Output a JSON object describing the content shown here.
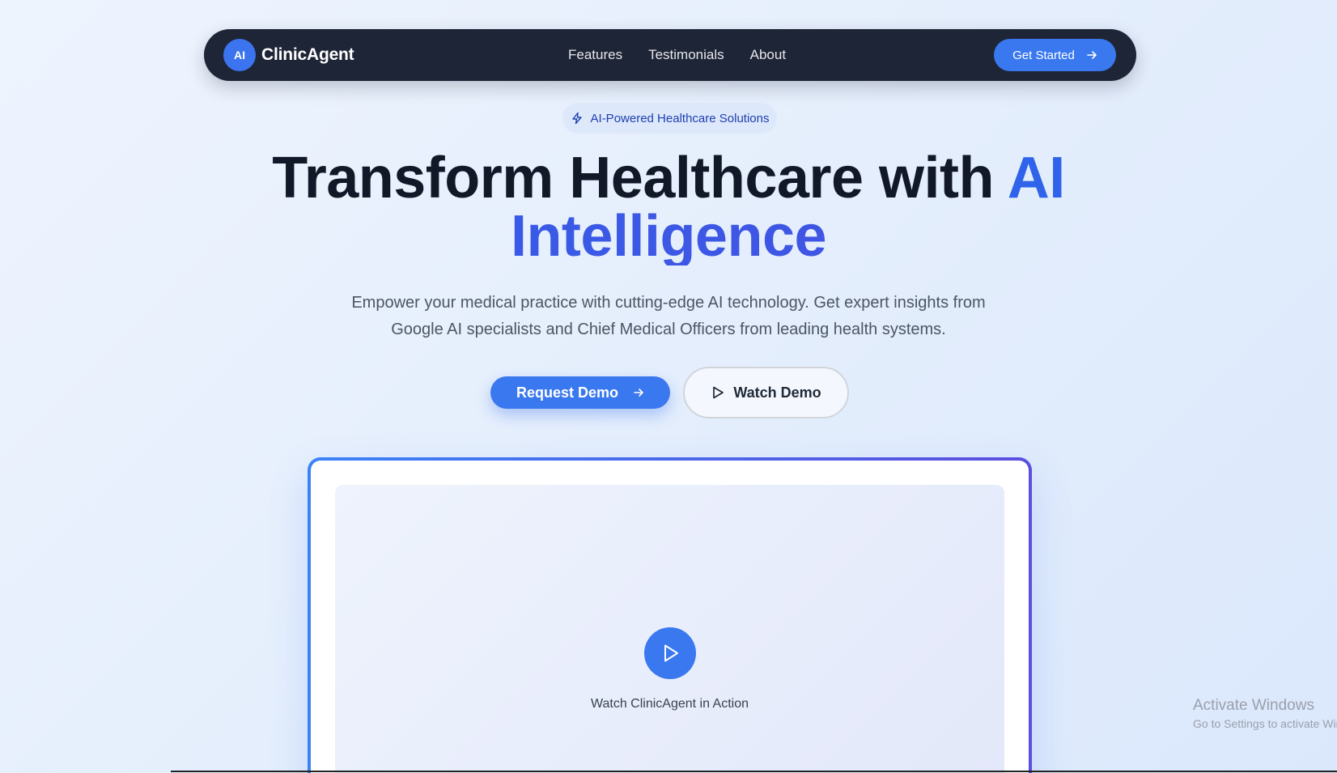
{
  "navbar": {
    "logo_text": "AI",
    "brand": "ClinicAgent",
    "links": [
      "Features",
      "Testimonials",
      "About"
    ],
    "cta_label": "Get Started"
  },
  "badge": {
    "icon": "lightning-icon",
    "label": "AI-Powered Healthcare Solutions"
  },
  "hero": {
    "headline_part1": "Transform Healthcare with ",
    "headline_accent1": "AI",
    "headline_accent2": "Intelligence",
    "subtext": "Empower your medical practice with cutting-edge AI technology. Get expert insights from Google AI specialists and Chief Medical Officers from leading health systems.",
    "primary_button": "Request Demo",
    "secondary_button": "Watch Demo"
  },
  "video": {
    "caption": "Watch ClinicAgent in Action",
    "icon": "play-icon"
  },
  "watermark": {
    "line1": "Activate Windows",
    "line2": "Go to Settings to activate Windows."
  },
  "colors": {
    "accent": "#3a78ef",
    "navbar_bg": "#1e2536",
    "gradient_end": "#4a4de0"
  }
}
